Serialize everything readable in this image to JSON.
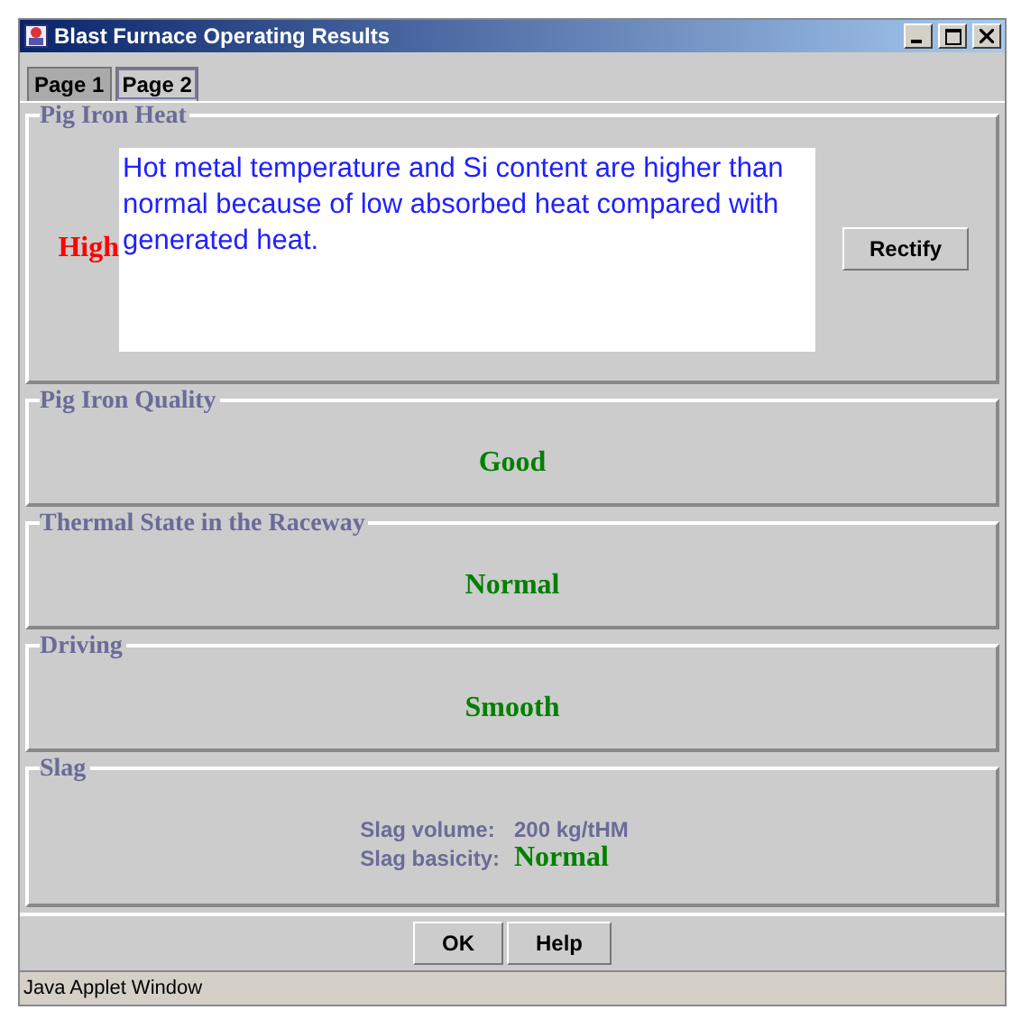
{
  "window": {
    "title": "Blast Furnace Operating Results"
  },
  "tabs": [
    {
      "label": "Page 1",
      "selected": true
    },
    {
      "label": "Page 2",
      "selected": false
    }
  ],
  "sections": [
    {
      "kind": "message",
      "title": "Pig Iron Heat",
      "status": "High",
      "color": "#ff0000",
      "message": "Hot metal temperature and Si content are higher than normal because of low absorbed heat compared with generated heat.",
      "button": "Rectify"
    },
    {
      "kind": "status",
      "title": "Pig Iron Quality",
      "status": "Good",
      "color": "#008000"
    },
    {
      "kind": "status",
      "title": "Thermal State in the Raceway",
      "status": "Normal",
      "color": "#008000"
    },
    {
      "kind": "status",
      "title": "Driving",
      "status": "Smooth",
      "color": "#008000"
    },
    {
      "kind": "slag",
      "title": "Slag",
      "rows": [
        {
          "label": "Slag volume:",
          "value": "200 kg/tHM",
          "kind": "plain"
        },
        {
          "label": "Slag basicity:",
          "value": "Normal",
          "kind": "status",
          "color": "#008000"
        }
      ]
    }
  ],
  "buttons": [
    "OK",
    "Help"
  ],
  "status_bar": "Java Applet Window"
}
